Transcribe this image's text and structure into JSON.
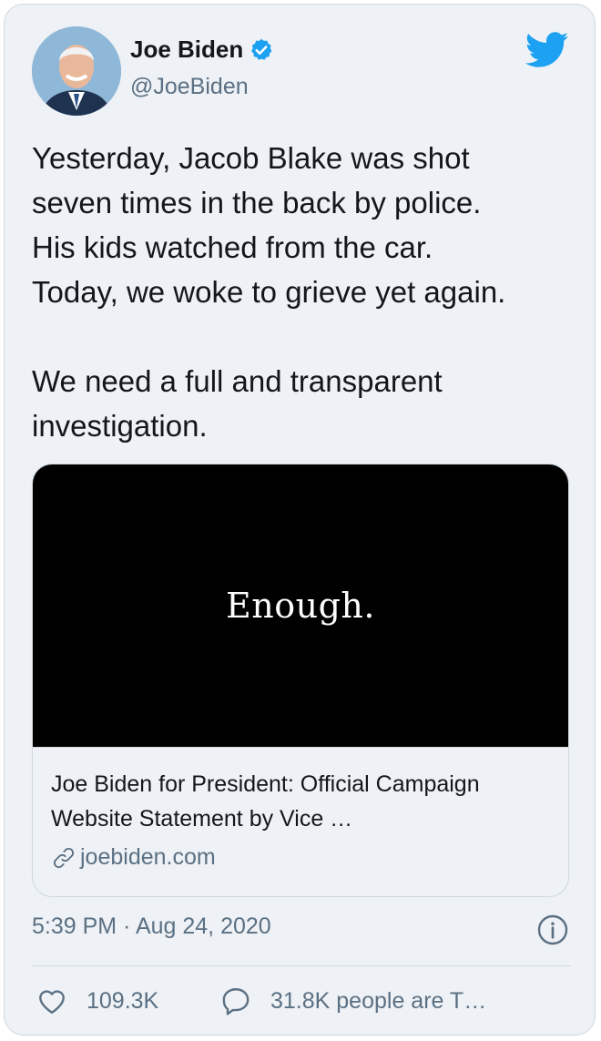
{
  "user": {
    "name": "Joe Biden",
    "handle": "@JoeBiden",
    "verified": true
  },
  "tweet": {
    "text": "Yesterday, Jacob Blake was shot\nseven times in the back by police.\nHis kids watched from the car.\nToday, we woke to grieve yet again.\n\nWe need a full and transparent\ninvestigation.",
    "timestamp": "5:39 PM · Aug 24, 2020"
  },
  "link_card": {
    "image_text": "Enough.",
    "title": "Joe Biden for President: Official Campaign Website Statement by Vice …",
    "domain": "joebiden.com"
  },
  "stats": {
    "likes": "109.3K",
    "replies": "31.8K people are T…"
  },
  "icons": {
    "brand": "twitter-bird-icon",
    "verified": "verified-badge-icon",
    "link": "link-icon",
    "info": "info-icon",
    "like": "heart-icon",
    "reply": "speech-bubble-icon"
  },
  "colors": {
    "brand": "#1da1f2",
    "background": "#eef1f5",
    "secondary_text": "#5b7083",
    "border": "#cfd9de"
  }
}
